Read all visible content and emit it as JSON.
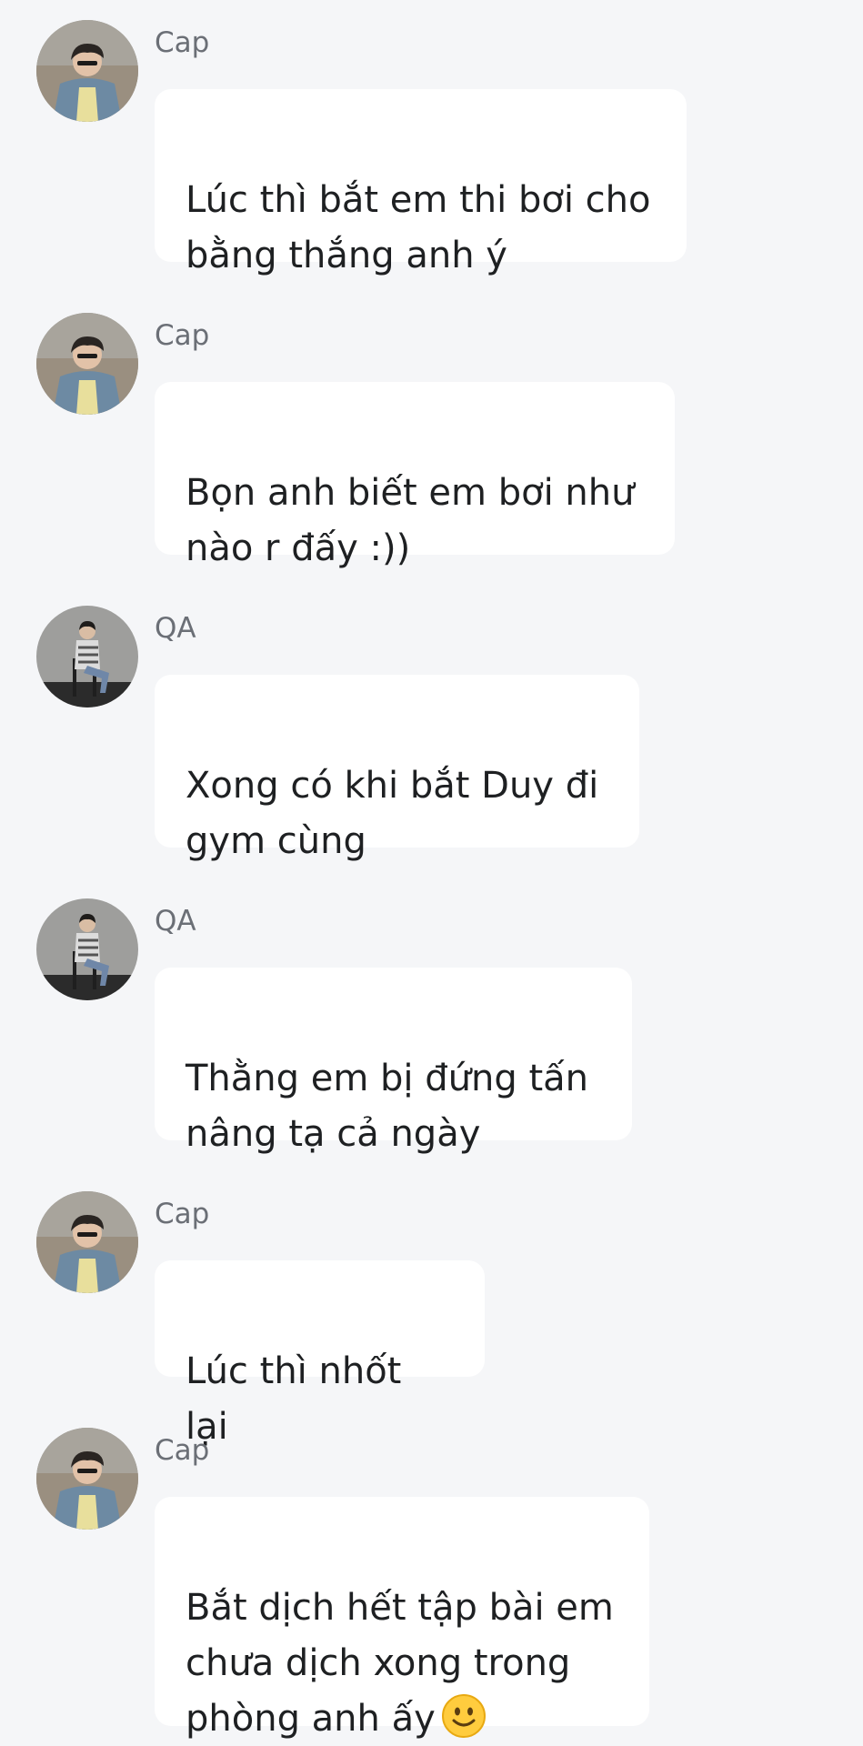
{
  "messages": [
    {
      "sender": "Cap",
      "text": "Lúc thì bắt em thi bơi cho\nbằng thắng anh ý",
      "emoji": ""
    },
    {
      "sender": "Cap",
      "text": "Bọn anh biết em bơi như\nnào r đấy :))",
      "emoji": ""
    },
    {
      "sender": "QA",
      "text": "Xong có khi bắt Duy đi\ngym cùng",
      "emoji": ""
    },
    {
      "sender": "QA",
      "text": "Thằng em bị đứng tấn\nnâng tạ cả ngày",
      "emoji": ""
    },
    {
      "sender": "Cap",
      "text": "Lúc thì nhốt lại",
      "emoji": ""
    },
    {
      "sender": "Cap",
      "text": "Bắt dịch hết tập bài em\nchưa dịch xong trong\nphòng anh ấy",
      "emoji": "slightly-smiling-face-icon"
    }
  ]
}
